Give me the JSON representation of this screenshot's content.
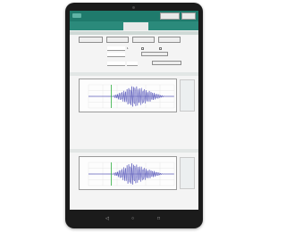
{
  "colors": {
    "appbar": "#1f7a6c",
    "tabs": "#2b8a7b",
    "trace": "#3b3bb0",
    "marker": "#2fae3f"
  },
  "tabs": [
    "",
    "",
    "",
    "",
    ""
  ],
  "top_buttons": [
    "",
    ""
  ],
  "sections": {
    "options": "",
    "result1": "",
    "result2": ""
  },
  "controls": {
    "buttons": [
      "",
      "",
      "",
      ""
    ],
    "row1": {
      "value": "1",
      "check_label": ""
    },
    "row2": {
      "button": ""
    },
    "row3": {
      "button": ""
    }
  },
  "charts": [
    {
      "title": "",
      "waveform": [
        0,
        0,
        0,
        0,
        0,
        0,
        0,
        0,
        0,
        0,
        0,
        0,
        0,
        0,
        0,
        0.15,
        -0.2,
        0.3,
        -0.35,
        0.45,
        -0.5,
        0.6,
        -0.7,
        0.8,
        -0.9,
        0.95,
        -1,
        0.95,
        -0.9,
        0.85,
        -0.8,
        0.75,
        -0.7,
        0.6,
        -0.55,
        0.5,
        -0.45,
        0.35,
        -0.3,
        0.25,
        -0.2,
        0.15,
        -0.1,
        0.05,
        0,
        0,
        0,
        0,
        0,
        0
      ],
      "marker_index": 13
    },
    {
      "title": "",
      "waveform": [
        0,
        0,
        0,
        0,
        0,
        0,
        0,
        0,
        0,
        0,
        0,
        0,
        0,
        0,
        0,
        0.15,
        -0.2,
        0.3,
        -0.4,
        0.5,
        -0.6,
        0.75,
        -0.85,
        0.95,
        -1,
        1,
        -0.95,
        0.9,
        -0.85,
        0.8,
        -0.7,
        0.65,
        -0.6,
        0.5,
        -0.45,
        0.4,
        -0.35,
        0.3,
        -0.25,
        0.2,
        -0.15,
        0.1,
        -0.05,
        0.02,
        0,
        0,
        0,
        0,
        0,
        0
      ],
      "marker_index": 13
    }
  ]
}
